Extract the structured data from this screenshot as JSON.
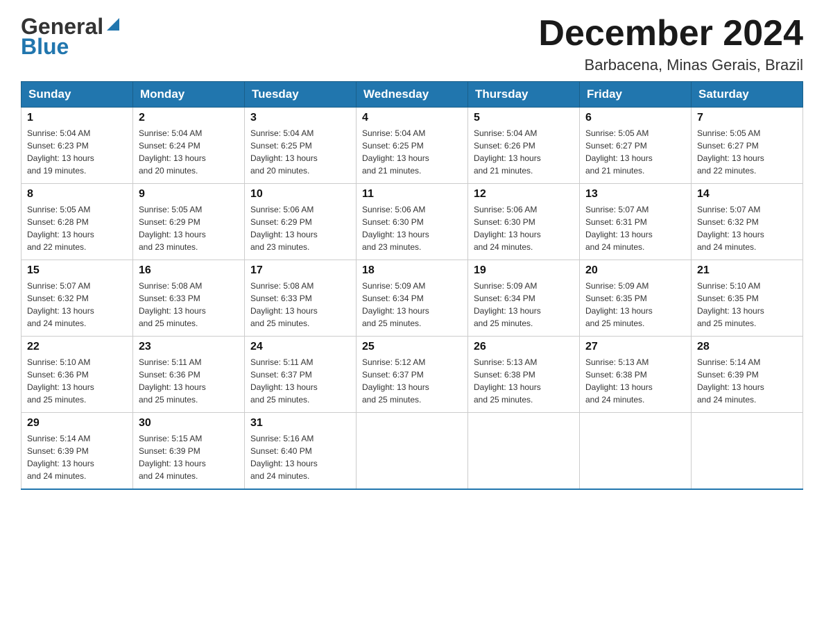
{
  "header": {
    "logo_general": "General",
    "logo_blue": "Blue",
    "month_title": "December 2024",
    "location": "Barbacena, Minas Gerais, Brazil"
  },
  "days_of_week": [
    "Sunday",
    "Monday",
    "Tuesday",
    "Wednesday",
    "Thursday",
    "Friday",
    "Saturday"
  ],
  "weeks": [
    [
      {
        "day": "1",
        "sunrise": "5:04 AM",
        "sunset": "6:23 PM",
        "daylight": "13 hours and 19 minutes."
      },
      {
        "day": "2",
        "sunrise": "5:04 AM",
        "sunset": "6:24 PM",
        "daylight": "13 hours and 20 minutes."
      },
      {
        "day": "3",
        "sunrise": "5:04 AM",
        "sunset": "6:25 PM",
        "daylight": "13 hours and 20 minutes."
      },
      {
        "day": "4",
        "sunrise": "5:04 AM",
        "sunset": "6:25 PM",
        "daylight": "13 hours and 21 minutes."
      },
      {
        "day": "5",
        "sunrise": "5:04 AM",
        "sunset": "6:26 PM",
        "daylight": "13 hours and 21 minutes."
      },
      {
        "day": "6",
        "sunrise": "5:05 AM",
        "sunset": "6:27 PM",
        "daylight": "13 hours and 21 minutes."
      },
      {
        "day": "7",
        "sunrise": "5:05 AM",
        "sunset": "6:27 PM",
        "daylight": "13 hours and 22 minutes."
      }
    ],
    [
      {
        "day": "8",
        "sunrise": "5:05 AM",
        "sunset": "6:28 PM",
        "daylight": "13 hours and 22 minutes."
      },
      {
        "day": "9",
        "sunrise": "5:05 AM",
        "sunset": "6:29 PM",
        "daylight": "13 hours and 23 minutes."
      },
      {
        "day": "10",
        "sunrise": "5:06 AM",
        "sunset": "6:29 PM",
        "daylight": "13 hours and 23 minutes."
      },
      {
        "day": "11",
        "sunrise": "5:06 AM",
        "sunset": "6:30 PM",
        "daylight": "13 hours and 23 minutes."
      },
      {
        "day": "12",
        "sunrise": "5:06 AM",
        "sunset": "6:30 PM",
        "daylight": "13 hours and 24 minutes."
      },
      {
        "day": "13",
        "sunrise": "5:07 AM",
        "sunset": "6:31 PM",
        "daylight": "13 hours and 24 minutes."
      },
      {
        "day": "14",
        "sunrise": "5:07 AM",
        "sunset": "6:32 PM",
        "daylight": "13 hours and 24 minutes."
      }
    ],
    [
      {
        "day": "15",
        "sunrise": "5:07 AM",
        "sunset": "6:32 PM",
        "daylight": "13 hours and 24 minutes."
      },
      {
        "day": "16",
        "sunrise": "5:08 AM",
        "sunset": "6:33 PM",
        "daylight": "13 hours and 25 minutes."
      },
      {
        "day": "17",
        "sunrise": "5:08 AM",
        "sunset": "6:33 PM",
        "daylight": "13 hours and 25 minutes."
      },
      {
        "day": "18",
        "sunrise": "5:09 AM",
        "sunset": "6:34 PM",
        "daylight": "13 hours and 25 minutes."
      },
      {
        "day": "19",
        "sunrise": "5:09 AM",
        "sunset": "6:34 PM",
        "daylight": "13 hours and 25 minutes."
      },
      {
        "day": "20",
        "sunrise": "5:09 AM",
        "sunset": "6:35 PM",
        "daylight": "13 hours and 25 minutes."
      },
      {
        "day": "21",
        "sunrise": "5:10 AM",
        "sunset": "6:35 PM",
        "daylight": "13 hours and 25 minutes."
      }
    ],
    [
      {
        "day": "22",
        "sunrise": "5:10 AM",
        "sunset": "6:36 PM",
        "daylight": "13 hours and 25 minutes."
      },
      {
        "day": "23",
        "sunrise": "5:11 AM",
        "sunset": "6:36 PM",
        "daylight": "13 hours and 25 minutes."
      },
      {
        "day": "24",
        "sunrise": "5:11 AM",
        "sunset": "6:37 PM",
        "daylight": "13 hours and 25 minutes."
      },
      {
        "day": "25",
        "sunrise": "5:12 AM",
        "sunset": "6:37 PM",
        "daylight": "13 hours and 25 minutes."
      },
      {
        "day": "26",
        "sunrise": "5:13 AM",
        "sunset": "6:38 PM",
        "daylight": "13 hours and 25 minutes."
      },
      {
        "day": "27",
        "sunrise": "5:13 AM",
        "sunset": "6:38 PM",
        "daylight": "13 hours and 24 minutes."
      },
      {
        "day": "28",
        "sunrise": "5:14 AM",
        "sunset": "6:39 PM",
        "daylight": "13 hours and 24 minutes."
      }
    ],
    [
      {
        "day": "29",
        "sunrise": "5:14 AM",
        "sunset": "6:39 PM",
        "daylight": "13 hours and 24 minutes."
      },
      {
        "day": "30",
        "sunrise": "5:15 AM",
        "sunset": "6:39 PM",
        "daylight": "13 hours and 24 minutes."
      },
      {
        "day": "31",
        "sunrise": "5:16 AM",
        "sunset": "6:40 PM",
        "daylight": "13 hours and 24 minutes."
      },
      null,
      null,
      null,
      null
    ]
  ],
  "labels": {
    "sunrise": "Sunrise:",
    "sunset": "Sunset:",
    "daylight": "Daylight:"
  }
}
